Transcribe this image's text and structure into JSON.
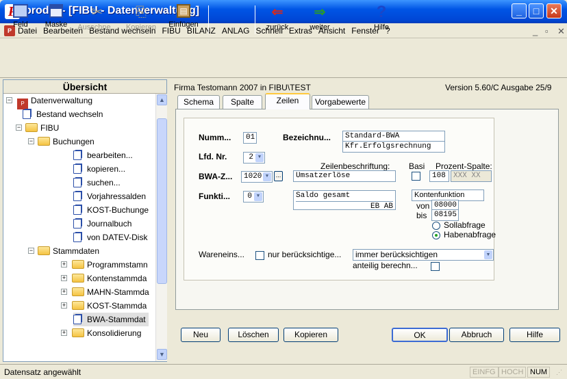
{
  "window": {
    "title": "prodat - [FIBU - Datenverwaltung]",
    "app_icon": "P"
  },
  "menu": [
    "Datei",
    "Bearbeiten",
    "Bestand wechseln",
    "FIBU",
    "BILANZ",
    "ANLAG",
    "Schnell",
    "Extras",
    "Ansicht",
    "Fenster",
    "?"
  ],
  "toolbar": {
    "feld": "Feld",
    "maske": "Maske",
    "ausschneiden": "Ausschne...",
    "kopieren": "Kopieren",
    "einfuegen": "Einfügen",
    "zurueck": "zurück",
    "weiter": "weiter",
    "hilfe": "Hilfe"
  },
  "left": {
    "header": "Übersicht",
    "tree": {
      "root": "Datenverwaltung",
      "bestand": "Bestand wechseln",
      "fibu": "FIBU",
      "buchungen": "Buchungen",
      "bearbeiten": "bearbeiten...",
      "kopieren": "kopieren...",
      "suchen": "suchen...",
      "vorjahr": "Vorjahressalden",
      "kost_buchungen": "KOST-Buchunge",
      "journal": "Journalbuch",
      "datev": "von DATEV-Disk",
      "stamm": "Stammdaten",
      "programm": "Programmstamn",
      "konten": "Kontenstammda",
      "mahn": "MAHN-Stammda",
      "kost_stamm": "KOST-Stammda",
      "bwa": "BWA-Stammdat",
      "konsol": "Konsolidierung"
    }
  },
  "right": {
    "company": "Firma Testomann 2007 in FIBU\\TEST",
    "version": "Version 5.60/C Ausgabe 25/9",
    "tabs": [
      "Schema",
      "Spalte",
      "Zeilen",
      "Vorgabewerte"
    ],
    "form": {
      "nummer_label": "Numm...",
      "nummer": "01",
      "bez_label": "Bezeichnu...",
      "bez1": "Standard-BWA",
      "bez2": "Kfr.Erfolgsrechnung",
      "lfd_label": "Lfd. Nr.",
      "lfd": "2",
      "zeilenbeschr_label": "Zeilenbeschriftung:",
      "basis_label": "Basi",
      "prozent_label": "Prozent-Spalte:",
      "bwaz_label": "BWA-Z...",
      "bwaz": "1020",
      "zeilenbeschr": "Umsatzerlöse",
      "prozent1": "108",
      "prozent2": "XXX XX",
      "funkt_label": "Funkti...",
      "funkt": "0",
      "saldo": "Saldo gesamt",
      "ebab": "EB  AB",
      "kontenfunktion": "Kontenfunktion",
      "von_label": "von",
      "von": "08000",
      "bis_label": "bis",
      "bis": "08195",
      "soll": "Sollabfrage",
      "haben": "Habenabfrage",
      "warenein_label": "Wareneins...",
      "nur_label": "nur berücksichtige...",
      "immer": "immer berücksichtigen",
      "anteilig_label": "anteilig berechn..."
    },
    "buttons": {
      "neu": "Neu",
      "loeschen": "Löschen",
      "kopieren": "Kopieren",
      "ok": "OK",
      "abbruch": "Abbruch",
      "hilfe": "Hilfe"
    }
  },
  "status": {
    "text": "Datensatz angewählt",
    "einfg": "EINFG",
    "hoch": "HOCH",
    "num": "NUM"
  }
}
